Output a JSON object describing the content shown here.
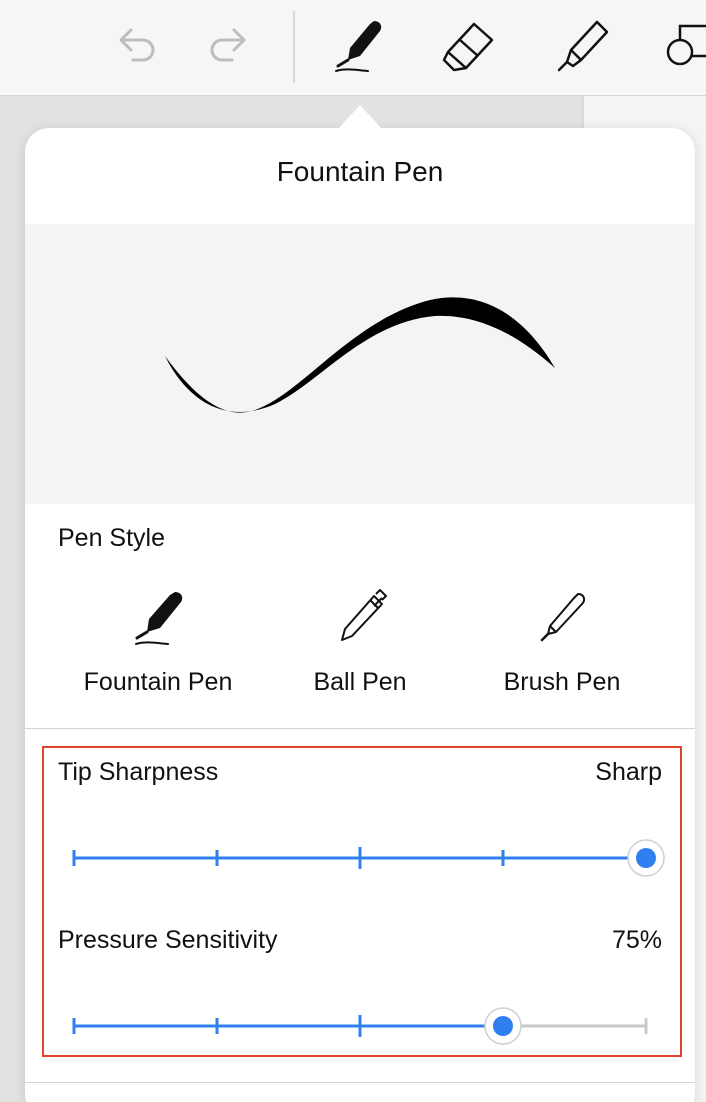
{
  "toolbar": {
    "icons": [
      "undo-icon",
      "redo-icon",
      "fountain-pen-tool-icon",
      "eraser-tool-icon",
      "highlighter-tool-icon",
      "shapes-tool-icon"
    ],
    "active_tool": "fountain-pen-tool-icon"
  },
  "popover": {
    "title": "Fountain Pen",
    "pen_style": {
      "label": "Pen Style",
      "options": [
        {
          "label": "Fountain Pen",
          "icon": "fountain-pen-icon",
          "selected": true
        },
        {
          "label": "Ball Pen",
          "icon": "ball-pen-icon",
          "selected": false
        },
        {
          "label": "Brush Pen",
          "icon": "brush-pen-icon",
          "selected": false
        }
      ]
    },
    "tip_sharpness": {
      "label": "Tip Sharpness",
      "value_text": "Sharp",
      "steps": 5,
      "level": 1.0
    },
    "pressure_sensitivity": {
      "label": "Pressure Sensitivity",
      "value_text": "75%",
      "steps": 5,
      "level": 0.75
    }
  },
  "colors": {
    "accent": "#2f7ff0",
    "track_inactive": "#c9c9c9",
    "highlight_border": "#e0442f",
    "preview_bg": "#f4f4f4",
    "icon_disabled": "#bdbdbd"
  }
}
